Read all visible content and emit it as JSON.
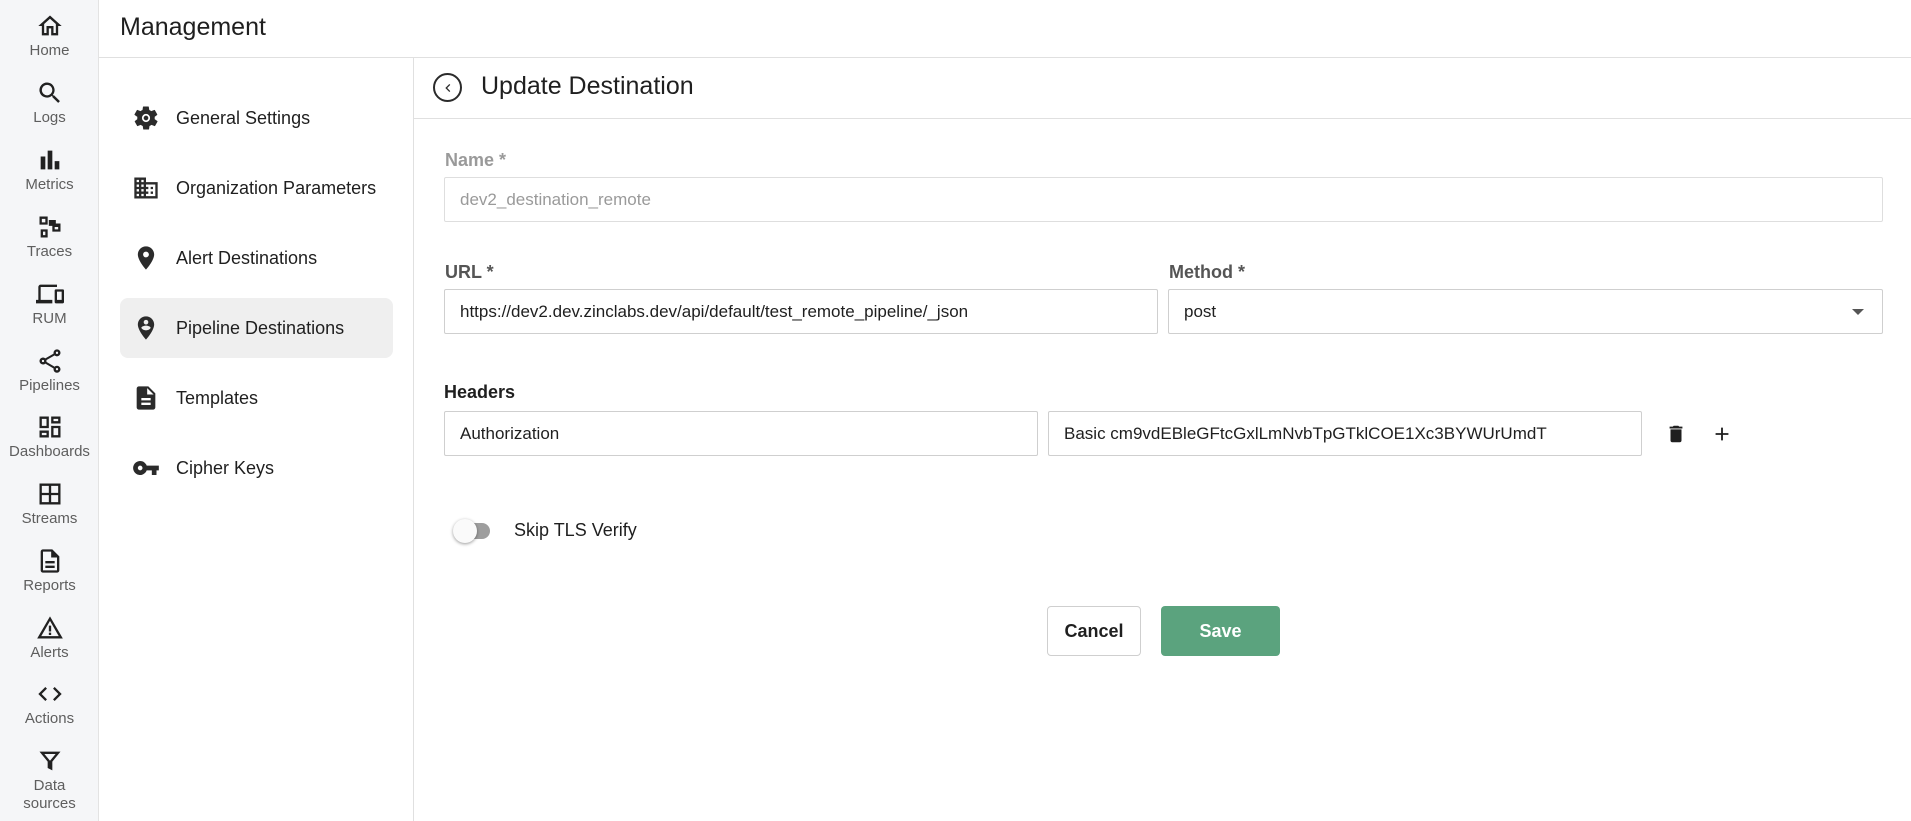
{
  "rail": {
    "items": [
      {
        "label": "Home",
        "icon": "home-icon"
      },
      {
        "label": "Logs",
        "icon": "search-icon"
      },
      {
        "label": "Metrics",
        "icon": "bar-chart-icon"
      },
      {
        "label": "Traces",
        "icon": "traces-icon"
      },
      {
        "label": "RUM",
        "icon": "devices-icon"
      },
      {
        "label": "Pipelines",
        "icon": "share-icon"
      },
      {
        "label": "Dashboards",
        "icon": "dashboard-icon"
      },
      {
        "label": "Streams",
        "icon": "grid-icon"
      },
      {
        "label": "Reports",
        "icon": "document-icon"
      },
      {
        "label": "Alerts",
        "icon": "warning-icon"
      },
      {
        "label": "Actions",
        "icon": "code-icon"
      },
      {
        "label": "Data sources",
        "icon": "filter-icon"
      }
    ]
  },
  "header": {
    "title": "Management"
  },
  "menu": {
    "items": [
      {
        "label": "General Settings",
        "icon": "gear-icon"
      },
      {
        "label": "Organization Parameters",
        "icon": "building-icon"
      },
      {
        "label": "Alert Destinations",
        "icon": "location-pin-icon"
      },
      {
        "label": "Pipeline Destinations",
        "icon": "person-pin-icon",
        "active": true
      },
      {
        "label": "Templates",
        "icon": "template-document-icon"
      },
      {
        "label": "Cipher Keys",
        "icon": "key-icon"
      }
    ]
  },
  "form": {
    "title": "Update Destination",
    "name_label": "Name *",
    "name_value": "dev2_destination_remote",
    "url_label": "URL *",
    "url_value": "https://dev2.dev.zinclabs.dev/api/default/test_remote_pipeline/_json",
    "method_label": "Method *",
    "method_value": "post",
    "headers_label": "Headers",
    "header_key": "Authorization",
    "header_value": "Basic cm9vdEBleGFtcGxlLmNvbTpGTklCOE1Xc3BYWUrUmdT",
    "skip_tls_label": "Skip TLS Verify",
    "skip_tls_enabled": false,
    "cancel_label": "Cancel",
    "save_label": "Save"
  },
  "colors": {
    "accent": "#5ba37e",
    "rail_bg": "#f5f6f8",
    "active_menu_bg": "#efefef"
  }
}
